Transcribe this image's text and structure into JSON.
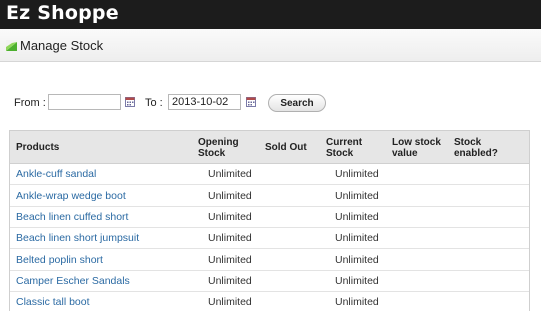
{
  "app": {
    "brand": "Ez Shoppe"
  },
  "page": {
    "title": "Manage Stock"
  },
  "filters": {
    "from_label": "From :",
    "from_value": "",
    "to_label": "To :",
    "to_value": "2013-10-02",
    "search_label": "Search"
  },
  "table": {
    "headers": {
      "products": "Products",
      "opening_1": "Opening",
      "opening_2": "Stock",
      "sold_out": "Sold Out",
      "current_1": "Current",
      "current_2": "Stock",
      "low_1": "Low stock",
      "low_2": "value",
      "enabled_1": "Stock",
      "enabled_2": "enabled?"
    },
    "rows": [
      {
        "product": "Ankle-cuff sandal",
        "opening": "Unlimited",
        "current": "Unlimited"
      },
      {
        "product": "Ankle-wrap wedge boot",
        "opening": "Unlimited",
        "current": "Unlimited"
      },
      {
        "product": "Beach linen cuffed short",
        "opening": "Unlimited",
        "current": "Unlimited"
      },
      {
        "product": "Beach linen short jumpsuit",
        "opening": "Unlimited",
        "current": "Unlimited"
      },
      {
        "product": "Belted poplin short",
        "opening": "Unlimited",
        "current": "Unlimited"
      },
      {
        "product": "Camper Escher Sandals",
        "opening": "Unlimited",
        "current": "Unlimited"
      },
      {
        "product": "Classic tall boot",
        "opening": "Unlimited",
        "current": "Unlimited"
      }
    ]
  },
  "icons": {
    "manage_stock": "bar-chart-icon",
    "calendar": "calendar-icon"
  }
}
